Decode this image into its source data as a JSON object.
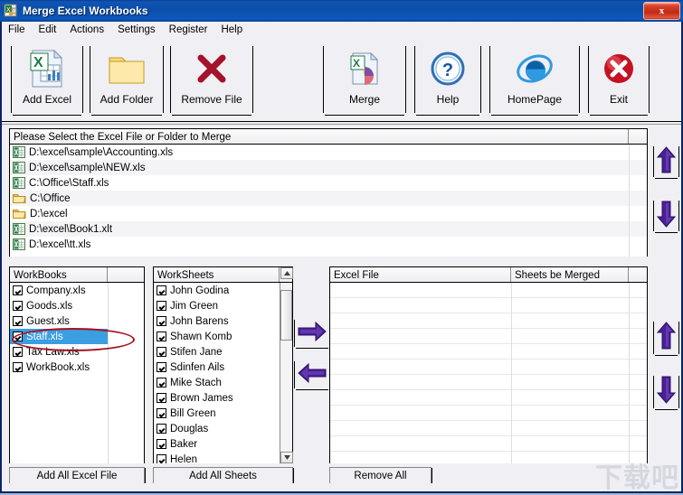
{
  "window": {
    "title": "Merge Excel Workbooks",
    "icon": "excel-merge-icon",
    "close_label": "x"
  },
  "menu": {
    "items": [
      {
        "label": "File"
      },
      {
        "label": "Edit"
      },
      {
        "label": "Actions"
      },
      {
        "label": "Settings"
      },
      {
        "label": "Register"
      },
      {
        "label": "Help"
      }
    ]
  },
  "toolbar": {
    "buttons": [
      {
        "label": "Add Excel",
        "icon": "excel-document-icon"
      },
      {
        "label": "Add Folder",
        "icon": "folder-icon"
      },
      {
        "label": "Remove File",
        "icon": "red-x-icon"
      },
      {
        "label": "Merge",
        "icon": "merge-documents-icon"
      },
      {
        "label": "Help",
        "icon": "question-mark-icon"
      },
      {
        "label": "HomePage",
        "icon": "internet-explorer-icon"
      },
      {
        "label": "Exit",
        "icon": "red-circle-x-icon"
      }
    ]
  },
  "file_list": {
    "header": "Please Select the Excel File or Folder to Merge",
    "rows": [
      {
        "icon": "excel-file-icon",
        "path": "D:\\excel\\sample\\Accounting.xls"
      },
      {
        "icon": "excel-file-icon",
        "path": "D:\\excel\\sample\\NEW.xls"
      },
      {
        "icon": "excel-file-icon",
        "path": "C:\\Office\\Staff.xls"
      },
      {
        "icon": "folder-icon",
        "path": "C:\\Office"
      },
      {
        "icon": "folder-icon",
        "path": "D:\\excel"
      },
      {
        "icon": "excel-file-icon",
        "path": "D:\\excel\\Book1.xlt"
      },
      {
        "icon": "excel-file-icon",
        "path": "D:\\excel\\tt.xls"
      }
    ]
  },
  "workbooks": {
    "header": "WorkBooks",
    "rows": [
      {
        "label": "Company.xls",
        "checked": true,
        "selected": false
      },
      {
        "label": "Goods.xls",
        "checked": true,
        "selected": false
      },
      {
        "label": "Guest.xls",
        "checked": true,
        "selected": false
      },
      {
        "label": "Staff.xls",
        "checked": true,
        "selected": true
      },
      {
        "label": "Tax Law.xls",
        "checked": true,
        "selected": false
      },
      {
        "label": "WorkBook.xls",
        "checked": true,
        "selected": false
      }
    ]
  },
  "worksheets": {
    "header": "WorkSheets",
    "rows": [
      {
        "label": "John Godina",
        "checked": true
      },
      {
        "label": "Jim Green",
        "checked": true
      },
      {
        "label": "John Barens",
        "checked": true
      },
      {
        "label": "Shawn Komb",
        "checked": true
      },
      {
        "label": "Stifen Jane",
        "checked": true
      },
      {
        "label": "Sdinfen Ails",
        "checked": true
      },
      {
        "label": "Mike Stach",
        "checked": true
      },
      {
        "label": "Brown James",
        "checked": true
      },
      {
        "label": "Bill Green",
        "checked": true
      },
      {
        "label": "Douglas",
        "checked": true
      },
      {
        "label": "Baker",
        "checked": true
      },
      {
        "label": "Helen",
        "checked": true
      }
    ]
  },
  "merge_list": {
    "columns": [
      "Excel File",
      "Sheets be Merged"
    ],
    "rows": []
  },
  "transfer": {
    "add_icon": "right-arrow-icon",
    "remove_icon": "left-arrow-icon"
  },
  "order_controls": {
    "up_icon": "up-arrow-icon",
    "down_icon": "down-arrow-icon"
  },
  "bottom_buttons": {
    "add_all_excel": "Add All Excel File",
    "add_all_sheets": "Add All Sheets",
    "remove_all": "Remove All"
  },
  "watermark": {
    "text": "下载吧"
  },
  "colors": {
    "titlebar": "#0d58bb",
    "selection": "#3a9ee0",
    "arrow_purple": "#4b1f96",
    "annotation_red": "#a41220",
    "face": "#f0eff3"
  }
}
